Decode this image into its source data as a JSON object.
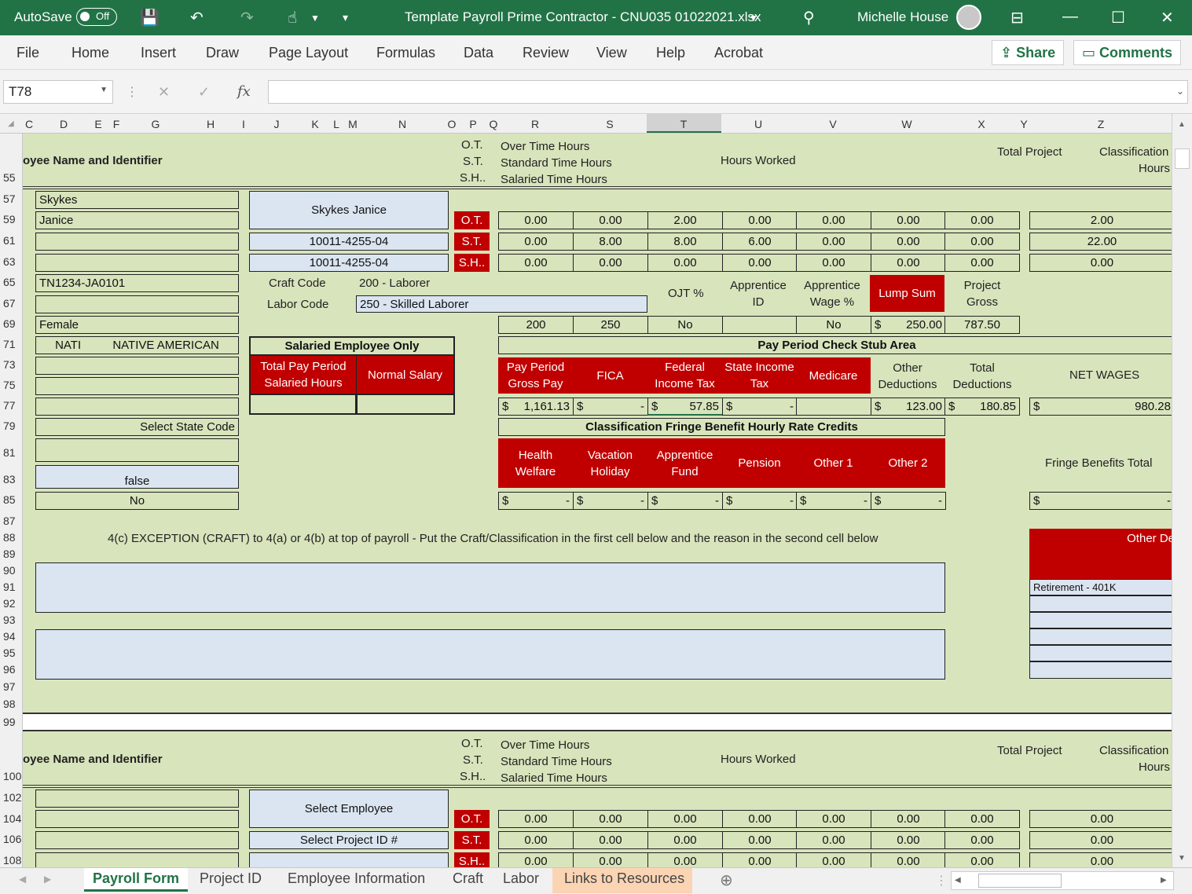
{
  "titlebar": {
    "autosave": "AutoSave",
    "autosave_state": "Off",
    "file_name": "Template Payroll Prime Contractor - CNU035 01022021.xlsx",
    "user": "Michelle House"
  },
  "ribbon": {
    "menus": [
      "File",
      "Home",
      "Insert",
      "Draw",
      "Page Layout",
      "Formulas",
      "Data",
      "Review",
      "View",
      "Help",
      "Acrobat"
    ],
    "share": "Share",
    "comments": "Comments"
  },
  "formula_bar": {
    "name_box": "T78",
    "fx": "fx",
    "formula": ""
  },
  "columns": [
    [
      "C",
      37
    ],
    [
      "D",
      81
    ],
    [
      "E",
      125
    ],
    [
      "F",
      148
    ],
    [
      "G",
      198
    ],
    [
      "H",
      268
    ],
    [
      "I",
      310
    ],
    [
      "J",
      352
    ],
    [
      "K",
      401
    ],
    [
      "L",
      428
    ],
    [
      "M",
      449
    ],
    [
      "N",
      512
    ],
    [
      "O",
      575
    ],
    [
      "P",
      602
    ],
    [
      "Q",
      628
    ],
    [
      "R",
      681
    ],
    [
      "S",
      776
    ],
    [
      "T",
      870
    ],
    [
      "U",
      965
    ],
    [
      "V",
      1060
    ],
    [
      "W",
      1154
    ],
    [
      "X",
      1249
    ],
    [
      "Y",
      1303
    ],
    [
      "Z",
      1401
    ]
  ],
  "rows": [
    [
      "55",
      227
    ],
    [
      "57",
      254
    ],
    [
      "59",
      280
    ],
    [
      "61",
      307
    ],
    [
      "63",
      334
    ],
    [
      "65",
      360
    ],
    [
      "67",
      387
    ],
    [
      "69",
      413
    ],
    [
      "71",
      439
    ],
    [
      "73",
      465
    ],
    [
      "75",
      491
    ],
    [
      "77",
      517
    ],
    [
      "79",
      543
    ],
    [
      "81",
      577
    ],
    [
      "83",
      611
    ],
    [
      "85",
      637
    ],
    [
      "87",
      664
    ],
    [
      "88",
      685
    ],
    [
      "89",
      706
    ],
    [
      "90",
      727
    ],
    [
      "91",
      748
    ],
    [
      "92",
      769
    ],
    [
      "93",
      790
    ],
    [
      "94",
      811
    ],
    [
      "95",
      832
    ],
    [
      "96",
      853
    ],
    [
      "97",
      875
    ],
    [
      "98",
      897
    ],
    [
      "99",
      920
    ],
    [
      "100",
      989
    ],
    [
      "102",
      1016
    ],
    [
      "104",
      1043
    ],
    [
      "106",
      1069
    ],
    [
      "108",
      1096
    ]
  ],
  "s1": {
    "emp_label": "oyee Name and Identifier",
    "ot": "O.T.",
    "st": "S.T.",
    "sh": "S.H..",
    "ot_desc": "Over Time Hours",
    "st_desc": "Standard Time Hours",
    "sh_desc": "Salaried Time Hours",
    "hours_worked": "Hours Worked",
    "total_project": "Total Project",
    "classification": "Classification",
    "hours": "Hours",
    "last": "Skykes",
    "first": "Janice",
    "full": "Skykes Janice",
    "id1": "10011-4255-04",
    "id2": "10011-4255-04",
    "ot_tag": "O.T.",
    "st_tag": "S.T.",
    "sh_tag": "S.H..",
    "ot_vals": [
      "0.00",
      "0.00",
      "2.00",
      "0.00",
      "0.00",
      "0.00",
      "0.00"
    ],
    "st_vals": [
      "0.00",
      "8.00",
      "8.00",
      "6.00",
      "0.00",
      "0.00",
      "0.00"
    ],
    "sh_vals": [
      "0.00",
      "0.00",
      "0.00",
      "0.00",
      "0.00",
      "0.00",
      "0.00"
    ],
    "ot_total": "2.00",
    "st_total": "22.00",
    "sh_total": "0.00",
    "classification_code": "TN1234-JA0101",
    "craft_code_label": "Craft Code",
    "craft_code": "200 - Laborer",
    "labor_code_label": "Labor Code",
    "labor_code": "250 - Skilled Laborer",
    "ojt": "OJT %",
    "app_id": "Apprentice ID",
    "app_wage": "Apprentice Wage %",
    "lump_sum": "Lump Sum",
    "project_gross": "Project Gross",
    "gender": "Female",
    "craft_val": "200",
    "labor_val": "250",
    "ojt_val": "No",
    "app_wage_val": "No",
    "lump_val": "250.00",
    "gross_val": "787.50",
    "race_code": "NATI",
    "race": "NATIVE AMERICAN",
    "salaried_title": "Salaried Employee Only",
    "total_pay_hours": "Total Pay Period Salaried Hours",
    "normal_salary": "Normal Salary",
    "stub_title": "Pay Period Check Stub Area",
    "stub_heads": [
      "Pay Period Gross Pay",
      "FICA",
      "Federal Income Tax",
      "State Income Tax",
      "Medicare"
    ],
    "other_ded": "Other Deductions",
    "total_ded": "Total Deductions",
    "net_wages": "NET WAGES",
    "gross_pay": "1,161.13",
    "fica": "-",
    "fed_tax": "57.85",
    "state_tax": "-",
    "other_ded_val": "123.00",
    "total_ded_val": "180.85",
    "net_val": "980.28",
    "dollar": "$",
    "state_code": "Select State Code",
    "fringe_title": "Classification Fringe Benefit Hourly Rate Credits",
    "fringe_heads": [
      "Health Welfare",
      "Vacation Holiday",
      "Apprentice Fund",
      "Pension",
      "Other 1",
      "Other 2"
    ],
    "fringe_total": "Fringe Benefits  Total",
    "fringe_dash": "-",
    "false_val": "false",
    "no_val": "No",
    "exception": "4(c) EXCEPTION (CRAFT) to 4(a) or 4(b) at top of payroll - Put the Craft/Classification in the first cell below and the reason in the second cell below",
    "other_de": "Other De",
    "retirement": "Retirement - 401K"
  },
  "s2": {
    "emp_label": "oyee Name and Identifier",
    "select_employee": "Select Employee",
    "select_project": "Select Project ID #",
    "ot_vals": [
      "0.00",
      "0.00",
      "0.00",
      "0.00",
      "0.00",
      "0.00",
      "0.00"
    ],
    "st_vals": [
      "0.00",
      "0.00",
      "0.00",
      "0.00",
      "0.00",
      "0.00",
      "0.00"
    ],
    "sh_vals": [
      "0.00",
      "0.00",
      "0.00",
      "0.00",
      "0.00",
      "0.00",
      "0.00"
    ],
    "ot_total": "0.00",
    "st_total": "0.00",
    "sh_total": "0.00"
  },
  "sheet_tabs": [
    "Payroll Form",
    "Project ID",
    "Employee Information",
    "Craft",
    "Labor",
    "Links to Resources"
  ],
  "colors": {
    "excel_green": "#217346",
    "sheet_bg": "#d8e4bc",
    "accent_red": "#c00000",
    "input_blue": "#dbe5f1"
  }
}
